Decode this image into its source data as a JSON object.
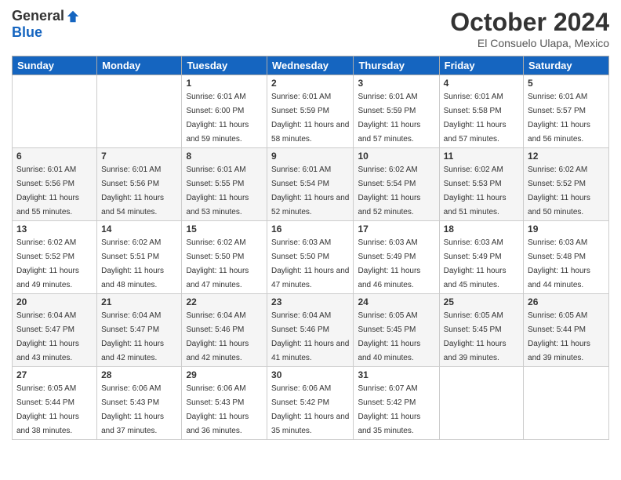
{
  "logo": {
    "general": "General",
    "blue": "Blue"
  },
  "header": {
    "month": "October 2024",
    "location": "El Consuelo Ulapa, Mexico"
  },
  "days_of_week": [
    "Sunday",
    "Monday",
    "Tuesday",
    "Wednesday",
    "Thursday",
    "Friday",
    "Saturday"
  ],
  "weeks": [
    [
      {
        "day": "",
        "info": ""
      },
      {
        "day": "",
        "info": ""
      },
      {
        "day": "1",
        "info": "Sunrise: 6:01 AM\nSunset: 6:00 PM\nDaylight: 11 hours and 59 minutes."
      },
      {
        "day": "2",
        "info": "Sunrise: 6:01 AM\nSunset: 5:59 PM\nDaylight: 11 hours and 58 minutes."
      },
      {
        "day": "3",
        "info": "Sunrise: 6:01 AM\nSunset: 5:59 PM\nDaylight: 11 hours and 57 minutes."
      },
      {
        "day": "4",
        "info": "Sunrise: 6:01 AM\nSunset: 5:58 PM\nDaylight: 11 hours and 57 minutes."
      },
      {
        "day": "5",
        "info": "Sunrise: 6:01 AM\nSunset: 5:57 PM\nDaylight: 11 hours and 56 minutes."
      }
    ],
    [
      {
        "day": "6",
        "info": "Sunrise: 6:01 AM\nSunset: 5:56 PM\nDaylight: 11 hours and 55 minutes."
      },
      {
        "day": "7",
        "info": "Sunrise: 6:01 AM\nSunset: 5:56 PM\nDaylight: 11 hours and 54 minutes."
      },
      {
        "day": "8",
        "info": "Sunrise: 6:01 AM\nSunset: 5:55 PM\nDaylight: 11 hours and 53 minutes."
      },
      {
        "day": "9",
        "info": "Sunrise: 6:01 AM\nSunset: 5:54 PM\nDaylight: 11 hours and 52 minutes."
      },
      {
        "day": "10",
        "info": "Sunrise: 6:02 AM\nSunset: 5:54 PM\nDaylight: 11 hours and 52 minutes."
      },
      {
        "day": "11",
        "info": "Sunrise: 6:02 AM\nSunset: 5:53 PM\nDaylight: 11 hours and 51 minutes."
      },
      {
        "day": "12",
        "info": "Sunrise: 6:02 AM\nSunset: 5:52 PM\nDaylight: 11 hours and 50 minutes."
      }
    ],
    [
      {
        "day": "13",
        "info": "Sunrise: 6:02 AM\nSunset: 5:52 PM\nDaylight: 11 hours and 49 minutes."
      },
      {
        "day": "14",
        "info": "Sunrise: 6:02 AM\nSunset: 5:51 PM\nDaylight: 11 hours and 48 minutes."
      },
      {
        "day": "15",
        "info": "Sunrise: 6:02 AM\nSunset: 5:50 PM\nDaylight: 11 hours and 47 minutes."
      },
      {
        "day": "16",
        "info": "Sunrise: 6:03 AM\nSunset: 5:50 PM\nDaylight: 11 hours and 47 minutes."
      },
      {
        "day": "17",
        "info": "Sunrise: 6:03 AM\nSunset: 5:49 PM\nDaylight: 11 hours and 46 minutes."
      },
      {
        "day": "18",
        "info": "Sunrise: 6:03 AM\nSunset: 5:49 PM\nDaylight: 11 hours and 45 minutes."
      },
      {
        "day": "19",
        "info": "Sunrise: 6:03 AM\nSunset: 5:48 PM\nDaylight: 11 hours and 44 minutes."
      }
    ],
    [
      {
        "day": "20",
        "info": "Sunrise: 6:04 AM\nSunset: 5:47 PM\nDaylight: 11 hours and 43 minutes."
      },
      {
        "day": "21",
        "info": "Sunrise: 6:04 AM\nSunset: 5:47 PM\nDaylight: 11 hours and 42 minutes."
      },
      {
        "day": "22",
        "info": "Sunrise: 6:04 AM\nSunset: 5:46 PM\nDaylight: 11 hours and 42 minutes."
      },
      {
        "day": "23",
        "info": "Sunrise: 6:04 AM\nSunset: 5:46 PM\nDaylight: 11 hours and 41 minutes."
      },
      {
        "day": "24",
        "info": "Sunrise: 6:05 AM\nSunset: 5:45 PM\nDaylight: 11 hours and 40 minutes."
      },
      {
        "day": "25",
        "info": "Sunrise: 6:05 AM\nSunset: 5:45 PM\nDaylight: 11 hours and 39 minutes."
      },
      {
        "day": "26",
        "info": "Sunrise: 6:05 AM\nSunset: 5:44 PM\nDaylight: 11 hours and 39 minutes."
      }
    ],
    [
      {
        "day": "27",
        "info": "Sunrise: 6:05 AM\nSunset: 5:44 PM\nDaylight: 11 hours and 38 minutes."
      },
      {
        "day": "28",
        "info": "Sunrise: 6:06 AM\nSunset: 5:43 PM\nDaylight: 11 hours and 37 minutes."
      },
      {
        "day": "29",
        "info": "Sunrise: 6:06 AM\nSunset: 5:43 PM\nDaylight: 11 hours and 36 minutes."
      },
      {
        "day": "30",
        "info": "Sunrise: 6:06 AM\nSunset: 5:42 PM\nDaylight: 11 hours and 35 minutes."
      },
      {
        "day": "31",
        "info": "Sunrise: 6:07 AM\nSunset: 5:42 PM\nDaylight: 11 hours and 35 minutes."
      },
      {
        "day": "",
        "info": ""
      },
      {
        "day": "",
        "info": ""
      }
    ]
  ]
}
